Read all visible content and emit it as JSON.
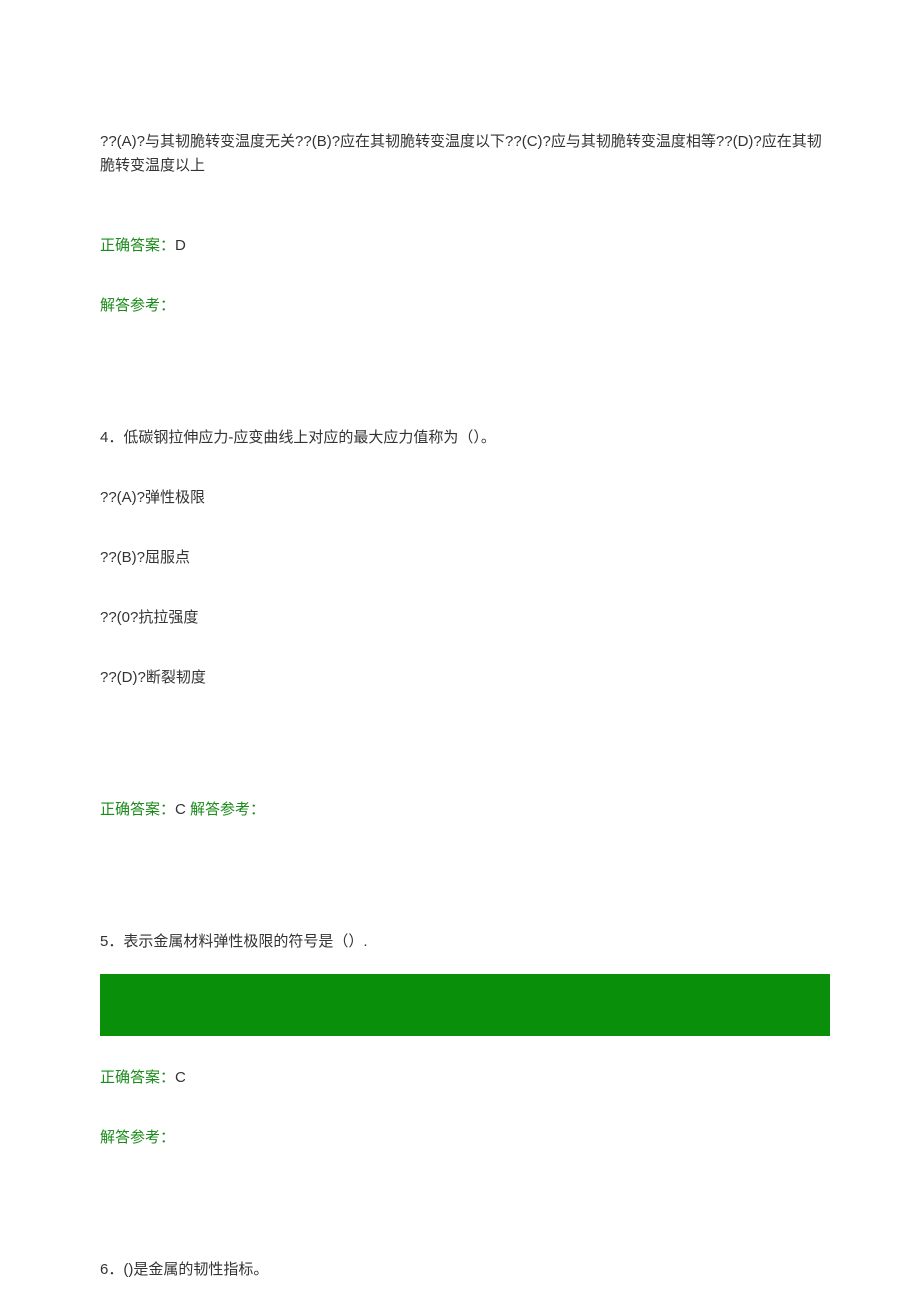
{
  "q3": {
    "options_text": "??(A)?与其韧脆转变温度无关??(B)?应在其韧脆转变温度以下??(C)?应与其韧脆转变温度相等??(D)?应在其韧脆转变温度以上",
    "answer_label": "正确答案：",
    "answer_value": "D",
    "ref_label": "解答参考："
  },
  "q4": {
    "number": "4",
    "stem": "．低碳钢拉伸应力-应变曲线上对应的最大应力值称为（）。",
    "options": {
      "a": "??(A)?弹性极限",
      "b": "??(B)?屈服点",
      "c": "??(0?抗拉强度",
      "d": "??(D)?断裂韧度"
    },
    "answer_label": "正确答案：",
    "answer_value": "C",
    "ref_label": " 解答参考："
  },
  "q5": {
    "number": "5",
    "stem": "．表示金属材料弹性极限的符号是（）.",
    "answer_label": "正确答案：",
    "answer_value": "C",
    "ref_label": "解答参考："
  },
  "q6": {
    "number": "6",
    "stem": "．()是金属的韧性指标。"
  }
}
